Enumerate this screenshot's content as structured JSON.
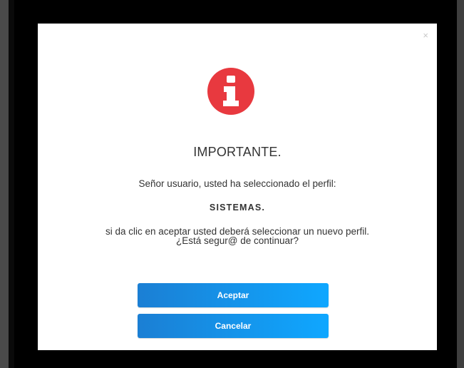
{
  "dialog": {
    "close_label": "×",
    "icon": "info-icon",
    "icon_color": "#e8393f",
    "title": "IMPORTANTE.",
    "message": "Señor usuario, usted ha seleccionado el perfil:",
    "profile_name": "SISTEMAS.",
    "question_line1": "si da clic en aceptar usted deberá seleccionar un nuevo perfil.",
    "question_line2": "¿Está segur@ de continuar?",
    "accept_label": "Aceptar",
    "cancel_label": "Cancelar",
    "button_color": "#1b8ee6"
  }
}
